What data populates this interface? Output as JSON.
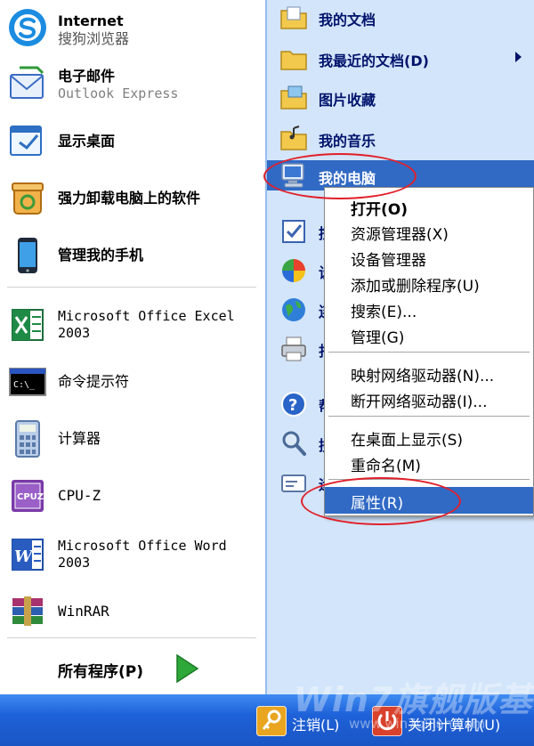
{
  "left_pane": {
    "pinned": [
      {
        "title": "Internet",
        "subtitle": "搜狗浏览器",
        "icon": "sogou-browser-icon"
      },
      {
        "title": "电子邮件",
        "subtitle": "Outlook Express",
        "icon": "email-icon"
      }
    ],
    "items": [
      {
        "label": "显示桌面",
        "icon": "show-desktop-icon"
      },
      {
        "label": "强力卸载电脑上的软件",
        "icon": "uninstall-icon"
      },
      {
        "label": "管理我的手机",
        "icon": "phone-icon"
      },
      {
        "label": "Microsoft Office Excel 2003",
        "line1": "Microsoft Office Excel",
        "line2": "2003",
        "icon": "excel-icon"
      },
      {
        "label": "命令提示符",
        "icon": "cmd-icon"
      },
      {
        "label": "计算器",
        "icon": "calculator-icon"
      },
      {
        "label": "CPU-Z",
        "icon": "cpuz-icon"
      },
      {
        "label": "Microsoft Office Word 2003",
        "line1": "Microsoft Office Word",
        "line2": "2003",
        "icon": "word-icon"
      },
      {
        "label": "WinRAR",
        "icon": "winrar-icon"
      }
    ],
    "all_programs": "所有程序(P)"
  },
  "right_pane": {
    "items": [
      {
        "label": "我的文档",
        "icon": "my-documents-icon"
      },
      {
        "label": "我最近的文档(D)",
        "icon": "recent-documents-icon"
      },
      {
        "label": "图片收藏",
        "icon": "my-pictures-icon"
      },
      {
        "label": "我的音乐",
        "icon": "my-music-icon"
      },
      {
        "label": "我的电脑",
        "icon": "my-computer-icon"
      },
      {
        "label": "控",
        "icon": "control-panel-icon"
      },
      {
        "label": "设",
        "icon": "default-programs-icon"
      },
      {
        "label": "连",
        "icon": "connect-to-icon"
      },
      {
        "label": "打",
        "icon": "printers-icon"
      },
      {
        "label": "帮",
        "icon": "help-icon"
      },
      {
        "label": "搜",
        "icon": "search-icon"
      },
      {
        "label": "运",
        "icon": "run-icon"
      }
    ]
  },
  "context_menu": {
    "items": [
      {
        "label": "打开(O)"
      },
      {
        "label": "资源管理器(X)"
      },
      {
        "label": "设备管理器"
      },
      {
        "label": "添加或删除程序(U)"
      },
      {
        "label": "搜索(E)..."
      },
      {
        "label": "管理(G)"
      },
      {
        "label": "映射网络驱动器(N)..."
      },
      {
        "label": "断开网络驱动器(I)..."
      },
      {
        "label": "在桌面上显示(S)"
      },
      {
        "label": "重命名(M)"
      },
      {
        "label": "属性(R)"
      }
    ]
  },
  "bottom_bar": {
    "logoff": "注销(L)",
    "shutdown": "关闭计算机(U)"
  },
  "watermark": {
    "text": "Win7旗舰版基地",
    "url": "www.win7qijian.com"
  },
  "colors": {
    "selection": "#316ac5",
    "right_pane_bg": "#d3e5fa",
    "right_text": "#00136b",
    "bar": "#1e61d8",
    "annotation": "#e0202a"
  }
}
